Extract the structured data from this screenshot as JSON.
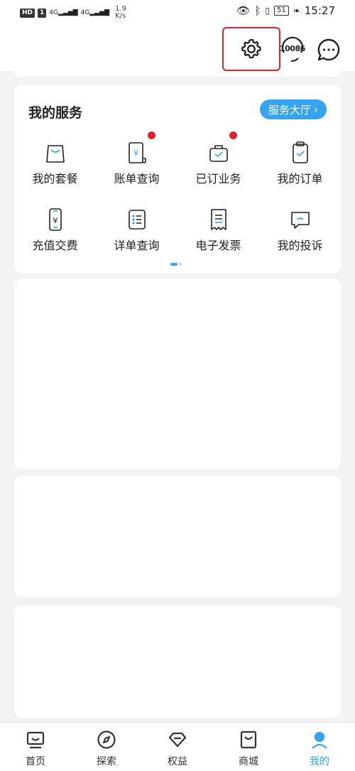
{
  "status_bar": {
    "hd": "HD",
    "sim1": "1",
    "network1": "4G",
    "network2": "4G",
    "speed_value": "1.9",
    "speed_unit": "K/s",
    "battery": "51",
    "time": "15:27"
  },
  "top_bar": {
    "service_hotline": "10086",
    "highlight_color": "#e0202a"
  },
  "services": {
    "title": "我的服务",
    "hall_button": "服务大厅",
    "accent_color": "#35a4f0",
    "items": [
      {
        "label": "我的套餐",
        "icon": "shopping-bag-icon",
        "badge": false
      },
      {
        "label": "账单查询",
        "icon": "bill-icon",
        "badge": true
      },
      {
        "label": "已订业务",
        "icon": "subscribed-briefcase-icon",
        "badge": true
      },
      {
        "label": "我的订单",
        "icon": "clipboard-check-icon",
        "badge": false
      },
      {
        "label": "充值交费",
        "icon": "phone-recharge-icon",
        "badge": false
      },
      {
        "label": "详单查询",
        "icon": "detail-list-icon",
        "badge": false
      },
      {
        "label": "电子发票",
        "icon": "receipt-icon",
        "badge": false
      },
      {
        "label": "我的投诉",
        "icon": "complaint-chat-icon",
        "badge": false
      }
    ],
    "pager": {
      "pages": 2,
      "current": 1
    }
  },
  "tab_bar": {
    "tabs": [
      {
        "label": "首页",
        "icon": "home-icon",
        "active": false
      },
      {
        "label": "探索",
        "icon": "compass-icon",
        "active": false
      },
      {
        "label": "权益",
        "icon": "diamond-icon",
        "active": false
      },
      {
        "label": "商城",
        "icon": "store-bag-icon",
        "active": false
      },
      {
        "label": "我的",
        "icon": "profile-icon",
        "active": true
      }
    ]
  }
}
